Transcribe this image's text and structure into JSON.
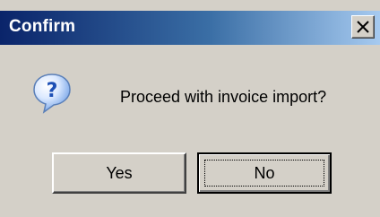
{
  "window": {
    "title": "Confirm",
    "close_icon": "close-icon"
  },
  "message": {
    "icon": "question-icon",
    "text": "Proceed with invoice import?"
  },
  "buttons": {
    "yes_label": "Yes",
    "no_label": "No",
    "default": "No"
  },
  "colors": {
    "titlebar_start": "#0a246a",
    "titlebar_end": "#a6caf0",
    "dialog_bg": "#d4d0c8",
    "icon_blue": "#2f6fd0"
  }
}
